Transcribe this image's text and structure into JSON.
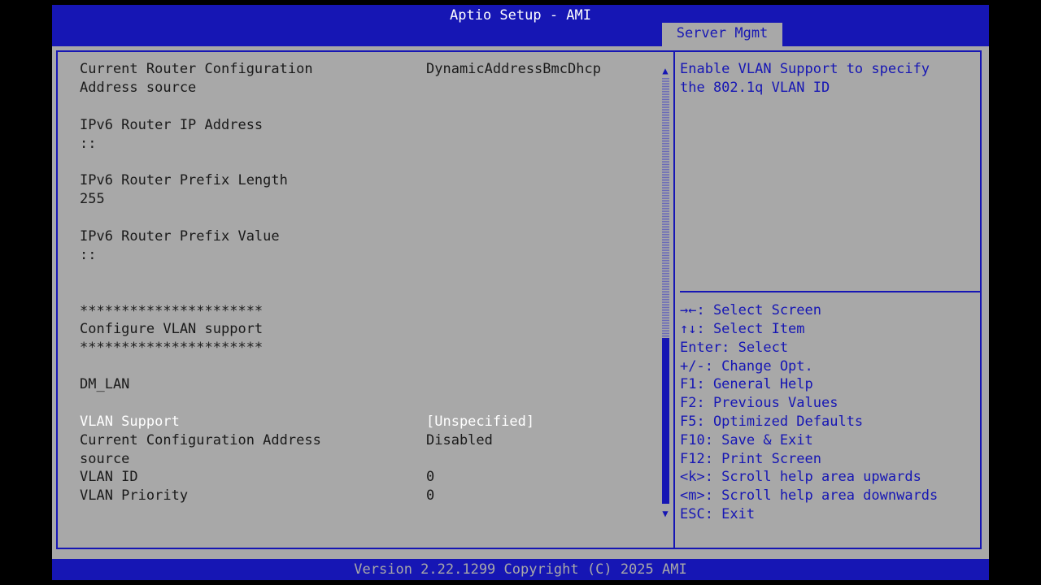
{
  "window": {
    "title": "Aptio Setup - AMI",
    "active_tab": "Server Mgmt"
  },
  "settings": [
    {
      "label": "Current Router Configuration",
      "label2": "Address source",
      "value": "DynamicAddressBmcDhcp"
    },
    {
      "label": "IPv6 Router IP Address",
      "value_line": "::"
    },
    {
      "label": "IPv6 Router Prefix Length",
      "value_line": "255"
    },
    {
      "label": "IPv6 Router Prefix Value",
      "value_line": "::"
    },
    {
      "stars": "**********************",
      "label": "Configure VLAN support"
    },
    {
      "label": "DM_LAN"
    },
    {
      "label": "VLAN Support",
      "value": "[Unspecified]"
    },
    {
      "label": "Current Configuration Address",
      "label2": "source",
      "value": "Disabled"
    },
    {
      "label": "VLAN ID",
      "value": "0"
    },
    {
      "label": "VLAN Priority",
      "value": "0"
    }
  ],
  "help": {
    "description": [
      "Enable VLAN Support to specify",
      "the 802.1q VLAN ID"
    ],
    "keys": [
      "→←: Select Screen",
      "↑↓: Select Item",
      "Enter: Select",
      "+/-: Change Opt.",
      "F1: General Help",
      "F2: Previous Values",
      "F5: Optimized Defaults",
      "F10: Save & Exit",
      "F12: Print Screen",
      "<k>: Scroll help area upwards",
      "<m>: Scroll help area downwards",
      "ESC: Exit"
    ]
  },
  "footer": {
    "version": "Version 2.22.1299 Copyright (C) 2025 AMI"
  },
  "colors": {
    "primary": "#1616b4",
    "background": "#a8a8a8",
    "selected_text": "#ffffff"
  },
  "scrollbar": {
    "position_fraction": 0.61,
    "visible_fraction": 0.39
  }
}
